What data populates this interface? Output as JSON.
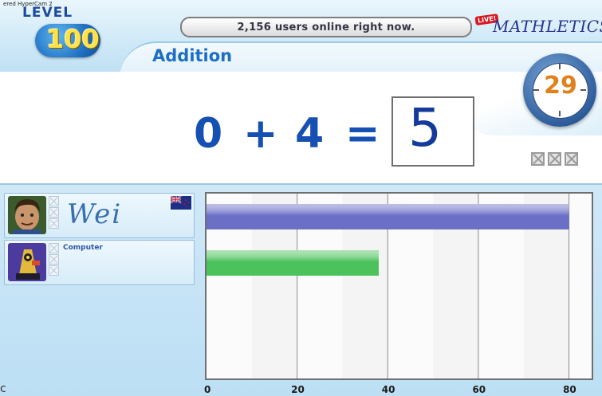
{
  "watermark": "ered HyperCam 2",
  "level": {
    "label": "LEVEL",
    "number": "100"
  },
  "online_status": "2,156 users online right now.",
  "brand": {
    "live_badge": "LIVE!",
    "name": "MATHLETICS"
  },
  "topic": "Addition",
  "question": {
    "left": "0",
    "op1": "+",
    "right": "4",
    "equals": "=",
    "answer": "5"
  },
  "timer": {
    "seconds": "29"
  },
  "strikes": {
    "count": 3
  },
  "players": [
    {
      "name": "Wei",
      "kind": "human",
      "flag": "new-zealand-flag"
    },
    {
      "name": "Computer",
      "kind": "computer"
    }
  ],
  "chart_data": {
    "type": "bar",
    "orientation": "horizontal",
    "categories": [
      "Wei",
      "Computer"
    ],
    "values": [
      80,
      38
    ],
    "colors": [
      "#6b6fc6",
      "#4cc25c"
    ],
    "xlim": [
      0,
      85
    ],
    "x_ticks": [
      0,
      20,
      40,
      60,
      80
    ],
    "grid": true
  },
  "stray_char": "c",
  "colors": {
    "accent": "#1c6fc4",
    "question": "#1750b3",
    "timer_number": "#e0811d"
  }
}
